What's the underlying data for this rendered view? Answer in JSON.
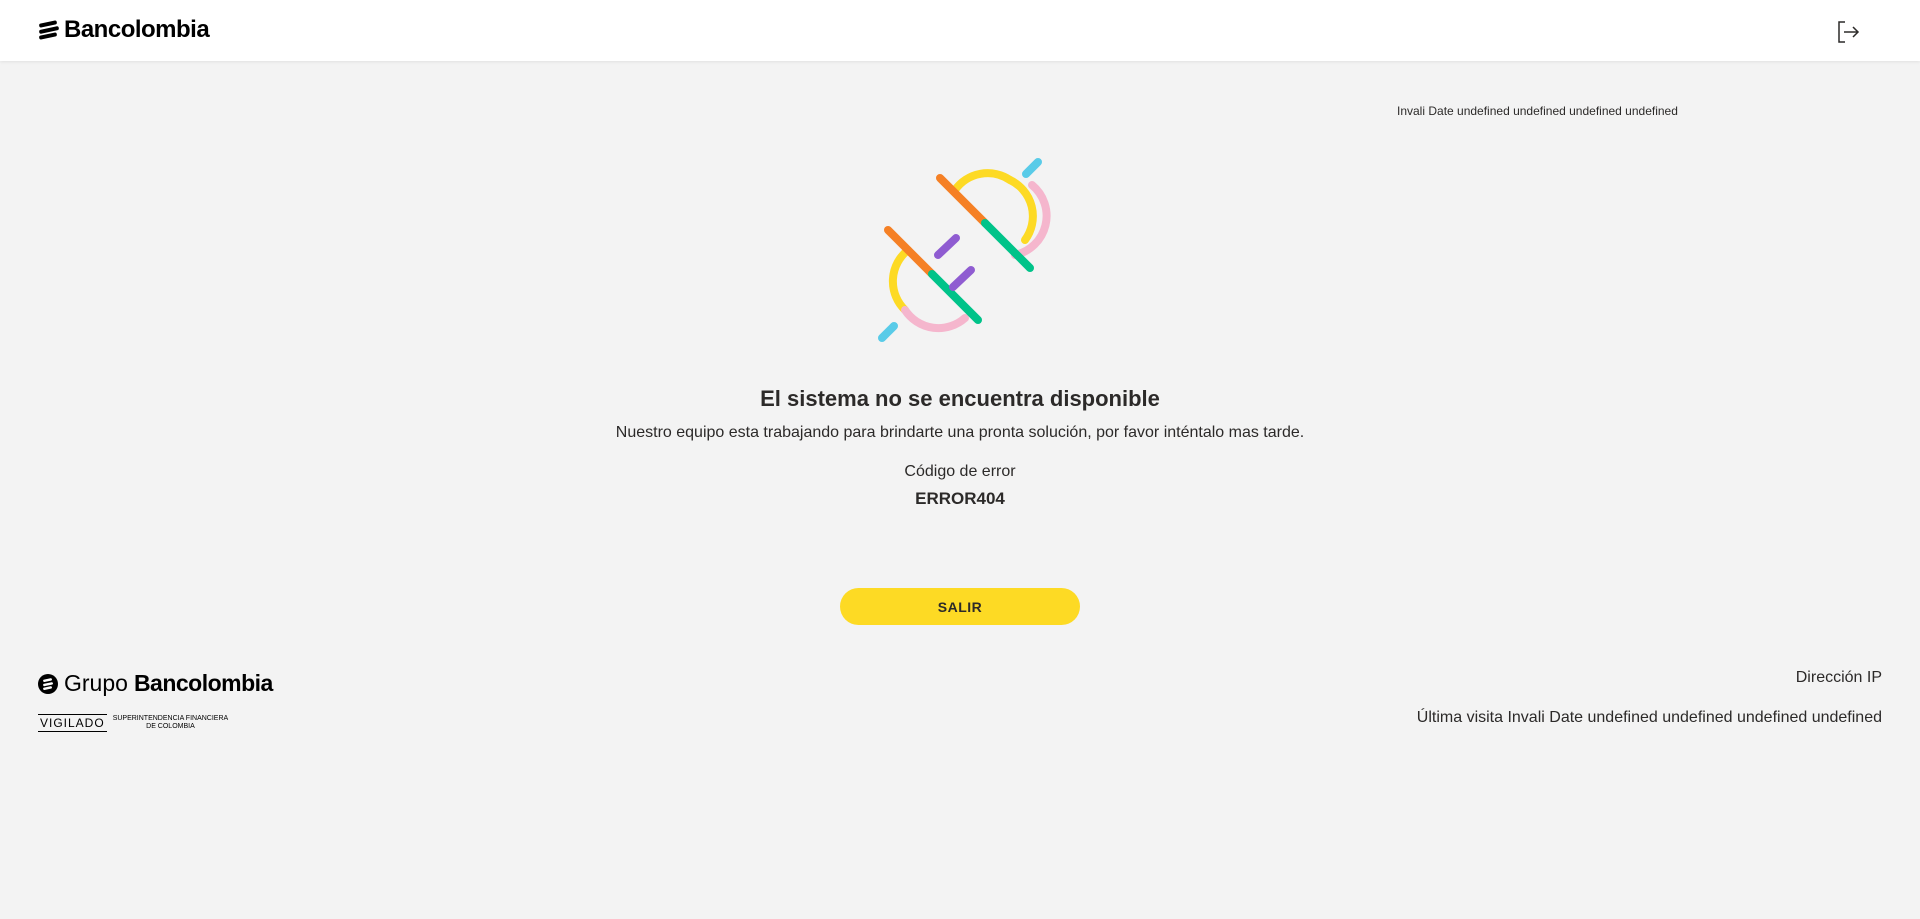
{
  "header": {
    "brand_name": "Bancolombia",
    "logout_icon": "logout-icon"
  },
  "top_date": "Invali Date undefined undefined undefined undefined",
  "error": {
    "illustration_icon": "unplugged-connector-icon",
    "title": "El sistema no se encuentra disponible",
    "subtitle": "Nuestro equipo esta trabajando para brindarte una pronta solución, por favor inténtalo mas tarde.",
    "code_label": "Código de error",
    "code_value": "ERROR404"
  },
  "actions": {
    "exit_label": "SALIR"
  },
  "footer": {
    "group_prefix": "Grupo",
    "group_name": "Bancolombia",
    "vigilado": "VIGILADO",
    "superintendencia_line1": "SUPERINTENDENCIA FINANCIERA",
    "superintendencia_line2": "DE COLOMBIA",
    "ip_label": "Dirección IP",
    "last_visit": "Última visita Invali Date undefined undefined undefined undefined"
  },
  "colors": {
    "accent_yellow": "#fdda24",
    "background": "#f3f3f3",
    "text": "#2c2a29"
  }
}
